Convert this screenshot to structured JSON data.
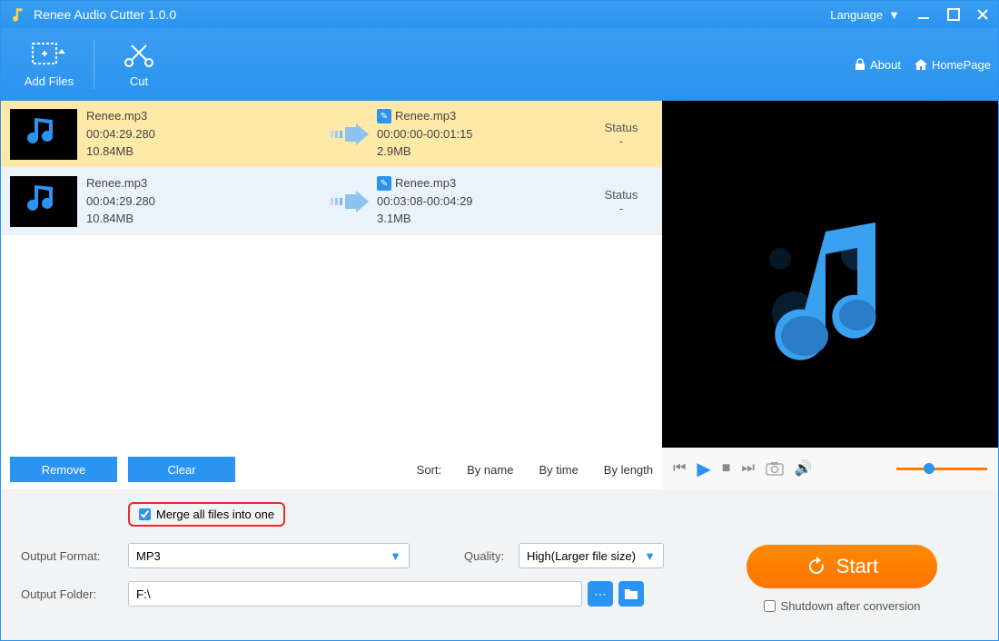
{
  "titlebar": {
    "title": "Renee Audio Cutter 1.0.0",
    "language": "Language"
  },
  "toolbar": {
    "add_files": "Add Files",
    "cut": "Cut",
    "about": "About",
    "homepage": "HomePage"
  },
  "files": [
    {
      "name": "Renee.mp3",
      "duration": "00:04:29.280",
      "size": "10.84MB",
      "out_name": "Renee.mp3",
      "out_range": "00:00:00-00:01:15",
      "out_size": "2.9MB",
      "status_label": "Status",
      "status_value": "-",
      "selected": true
    },
    {
      "name": "Renee.mp3",
      "duration": "00:04:29.280",
      "size": "10.84MB",
      "out_name": "Renee.mp3",
      "out_range": "00:03:08-00:04:29",
      "out_size": "3.1MB",
      "status_label": "Status",
      "status_value": "-",
      "selected": false
    }
  ],
  "actions": {
    "remove": "Remove",
    "clear": "Clear",
    "sort_label": "Sort:",
    "by_name": "By name",
    "by_time": "By time",
    "by_length": "By length"
  },
  "output": {
    "merge_label": "Merge all files into one",
    "merge_checked": true,
    "format_label": "Output Format:",
    "format_value": "MP3",
    "quality_label": "Quality:",
    "quality_value": "High(Larger file size)",
    "folder_label": "Output Folder:",
    "folder_value": "F:\\"
  },
  "start": {
    "label": "Start",
    "shutdown_label": "Shutdown after conversion",
    "shutdown_checked": false
  }
}
